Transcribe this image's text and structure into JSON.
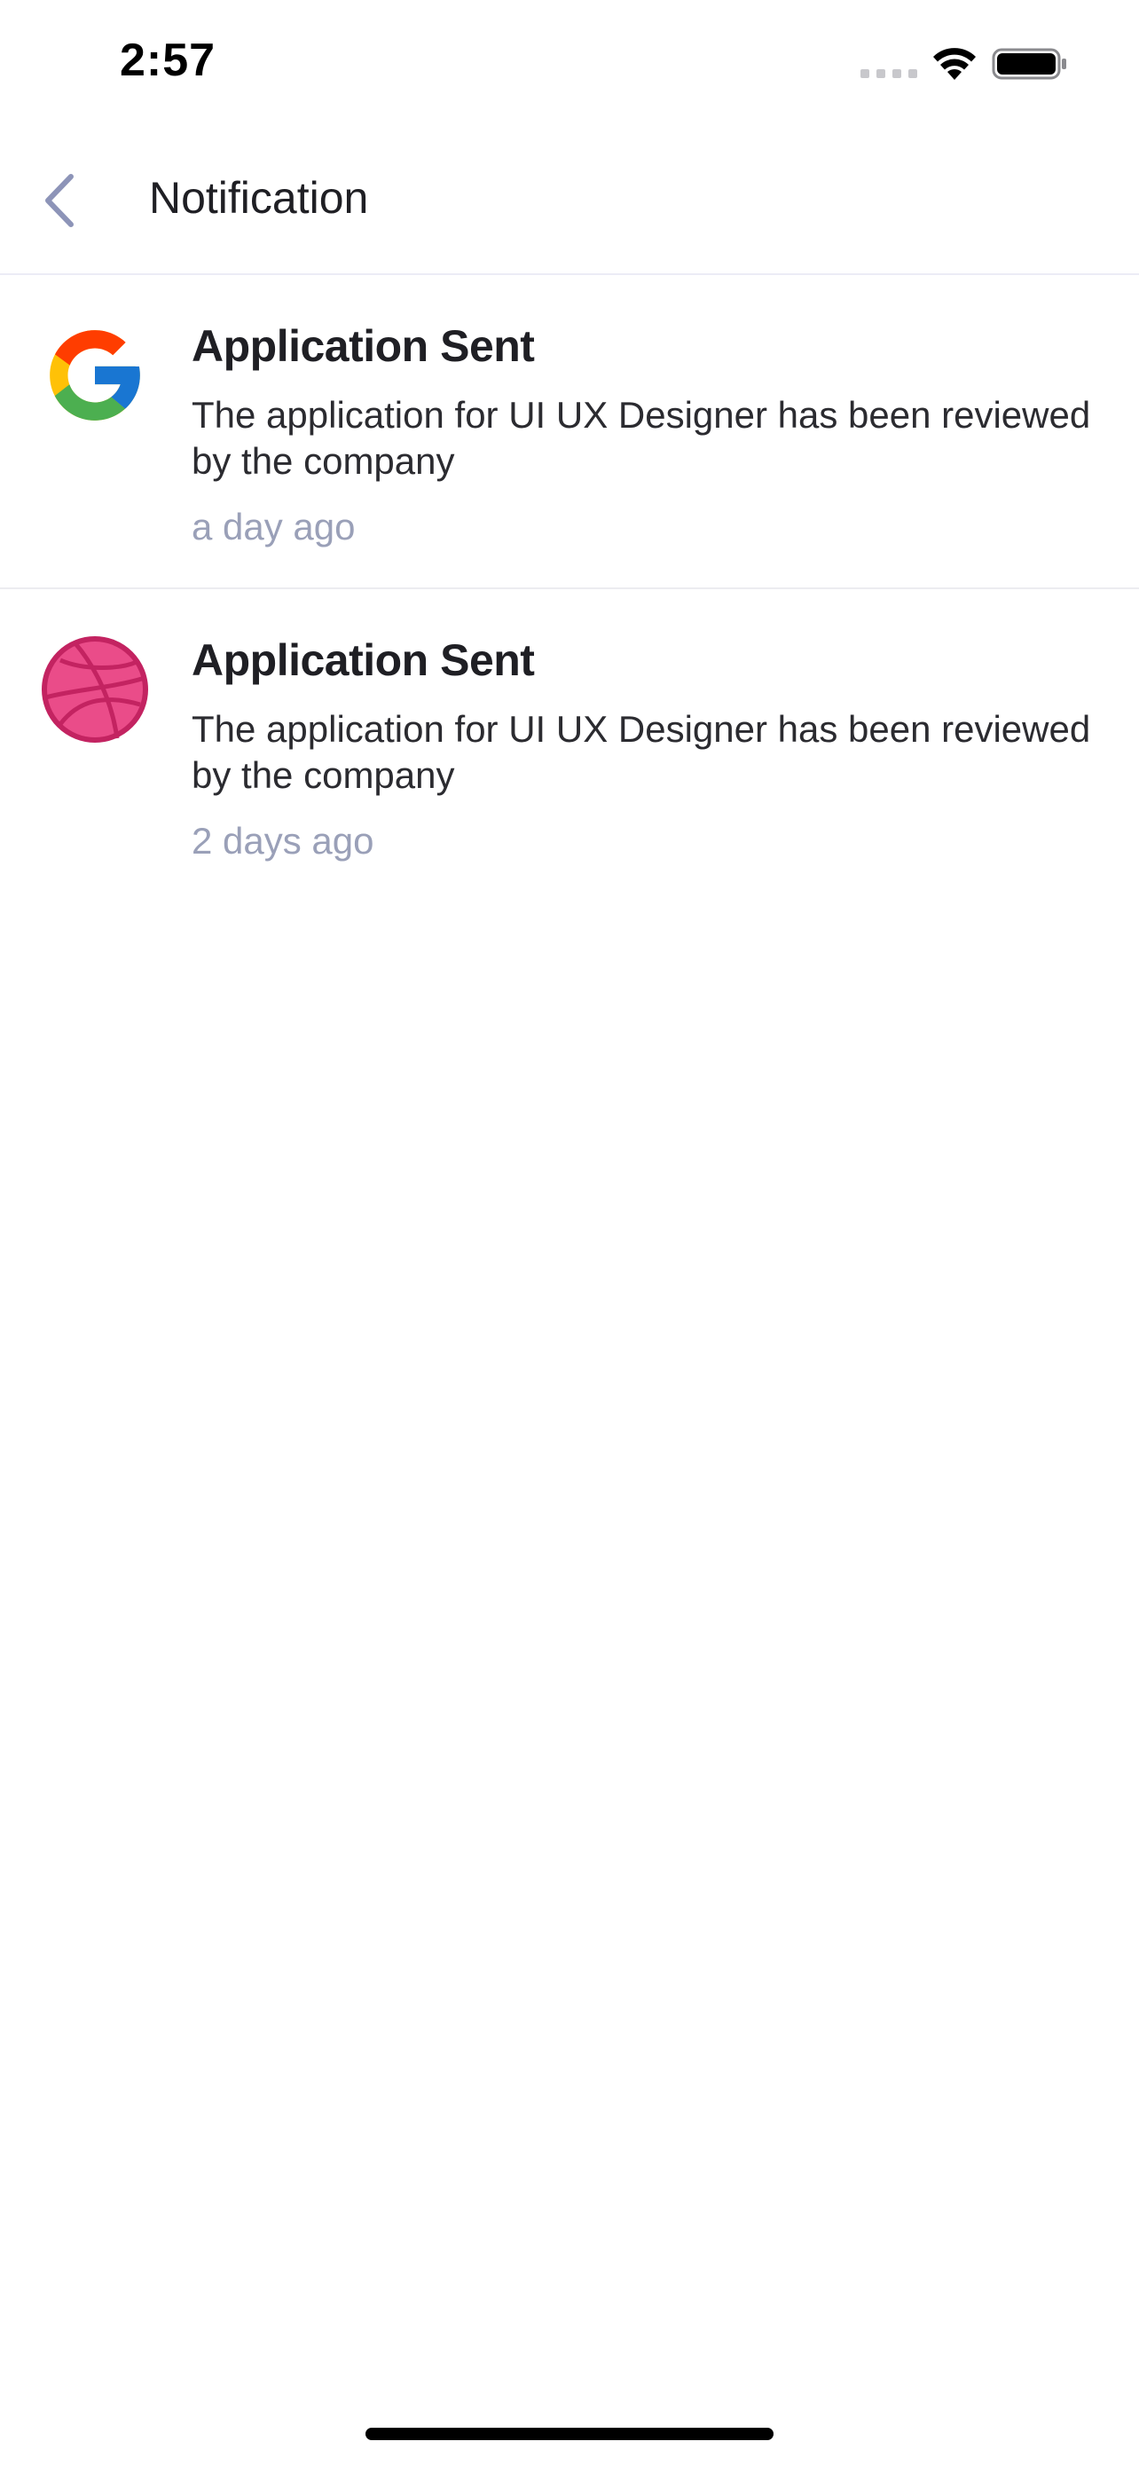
{
  "status_bar": {
    "time": "2:57"
  },
  "header": {
    "title": "Notification",
    "back_icon": "chevron-left-icon"
  },
  "notifications": [
    {
      "logo": "google-logo-icon",
      "title": "Application Sent",
      "body": "The application for UI UX Designer has been reviewed by the company",
      "time": "a day ago"
    },
    {
      "logo": "dribbble-logo-icon",
      "title": "Application Sent",
      "body": "The application for UI UX Designer has been reviewed by the company",
      "time": "2 days ago"
    }
  ],
  "colors": {
    "accent_back": "#8d94b8",
    "timestamp": "#9aa0b8",
    "divider": "#ececf6",
    "dribbble_pink": "#ea4c89",
    "dribbble_dark": "#c32361",
    "google_blue": "#4285f4",
    "google_red": "#ea4335",
    "google_yellow": "#fbbc05",
    "google_green": "#34a853"
  }
}
